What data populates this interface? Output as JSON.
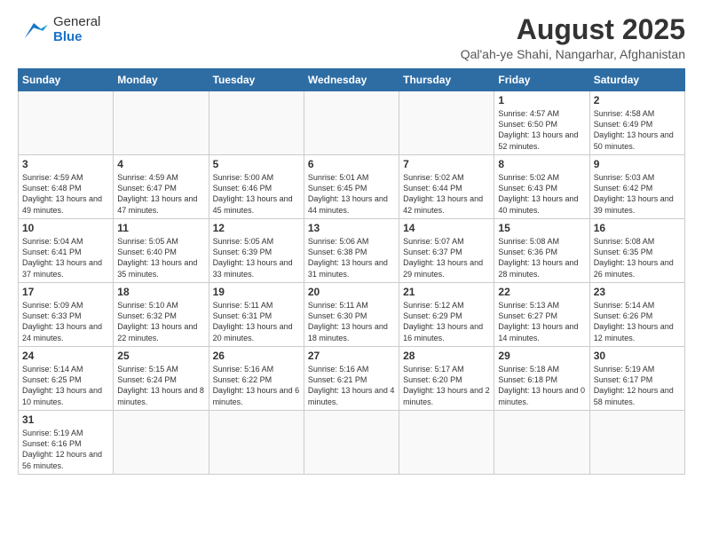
{
  "header": {
    "logo_general": "General",
    "logo_blue": "Blue",
    "title": "August 2025",
    "subtitle": "Qal'ah-ye Shahi, Nangarhar, Afghanistan"
  },
  "weekdays": [
    "Sunday",
    "Monday",
    "Tuesday",
    "Wednesday",
    "Thursday",
    "Friday",
    "Saturday"
  ],
  "weeks": [
    [
      {
        "day": "",
        "info": ""
      },
      {
        "day": "",
        "info": ""
      },
      {
        "day": "",
        "info": ""
      },
      {
        "day": "",
        "info": ""
      },
      {
        "day": "",
        "info": ""
      },
      {
        "day": "1",
        "info": "Sunrise: 4:57 AM\nSunset: 6:50 PM\nDaylight: 13 hours and 52 minutes."
      },
      {
        "day": "2",
        "info": "Sunrise: 4:58 AM\nSunset: 6:49 PM\nDaylight: 13 hours and 50 minutes."
      }
    ],
    [
      {
        "day": "3",
        "info": "Sunrise: 4:59 AM\nSunset: 6:48 PM\nDaylight: 13 hours and 49 minutes."
      },
      {
        "day": "4",
        "info": "Sunrise: 4:59 AM\nSunset: 6:47 PM\nDaylight: 13 hours and 47 minutes."
      },
      {
        "day": "5",
        "info": "Sunrise: 5:00 AM\nSunset: 6:46 PM\nDaylight: 13 hours and 45 minutes."
      },
      {
        "day": "6",
        "info": "Sunrise: 5:01 AM\nSunset: 6:45 PM\nDaylight: 13 hours and 44 minutes."
      },
      {
        "day": "7",
        "info": "Sunrise: 5:02 AM\nSunset: 6:44 PM\nDaylight: 13 hours and 42 minutes."
      },
      {
        "day": "8",
        "info": "Sunrise: 5:02 AM\nSunset: 6:43 PM\nDaylight: 13 hours and 40 minutes."
      },
      {
        "day": "9",
        "info": "Sunrise: 5:03 AM\nSunset: 6:42 PM\nDaylight: 13 hours and 39 minutes."
      }
    ],
    [
      {
        "day": "10",
        "info": "Sunrise: 5:04 AM\nSunset: 6:41 PM\nDaylight: 13 hours and 37 minutes."
      },
      {
        "day": "11",
        "info": "Sunrise: 5:05 AM\nSunset: 6:40 PM\nDaylight: 13 hours and 35 minutes."
      },
      {
        "day": "12",
        "info": "Sunrise: 5:05 AM\nSunset: 6:39 PM\nDaylight: 13 hours and 33 minutes."
      },
      {
        "day": "13",
        "info": "Sunrise: 5:06 AM\nSunset: 6:38 PM\nDaylight: 13 hours and 31 minutes."
      },
      {
        "day": "14",
        "info": "Sunrise: 5:07 AM\nSunset: 6:37 PM\nDaylight: 13 hours and 29 minutes."
      },
      {
        "day": "15",
        "info": "Sunrise: 5:08 AM\nSunset: 6:36 PM\nDaylight: 13 hours and 28 minutes."
      },
      {
        "day": "16",
        "info": "Sunrise: 5:08 AM\nSunset: 6:35 PM\nDaylight: 13 hours and 26 minutes."
      }
    ],
    [
      {
        "day": "17",
        "info": "Sunrise: 5:09 AM\nSunset: 6:33 PM\nDaylight: 13 hours and 24 minutes."
      },
      {
        "day": "18",
        "info": "Sunrise: 5:10 AM\nSunset: 6:32 PM\nDaylight: 13 hours and 22 minutes."
      },
      {
        "day": "19",
        "info": "Sunrise: 5:11 AM\nSunset: 6:31 PM\nDaylight: 13 hours and 20 minutes."
      },
      {
        "day": "20",
        "info": "Sunrise: 5:11 AM\nSunset: 6:30 PM\nDaylight: 13 hours and 18 minutes."
      },
      {
        "day": "21",
        "info": "Sunrise: 5:12 AM\nSunset: 6:29 PM\nDaylight: 13 hours and 16 minutes."
      },
      {
        "day": "22",
        "info": "Sunrise: 5:13 AM\nSunset: 6:27 PM\nDaylight: 13 hours and 14 minutes."
      },
      {
        "day": "23",
        "info": "Sunrise: 5:14 AM\nSunset: 6:26 PM\nDaylight: 13 hours and 12 minutes."
      }
    ],
    [
      {
        "day": "24",
        "info": "Sunrise: 5:14 AM\nSunset: 6:25 PM\nDaylight: 13 hours and 10 minutes."
      },
      {
        "day": "25",
        "info": "Sunrise: 5:15 AM\nSunset: 6:24 PM\nDaylight: 13 hours and 8 minutes."
      },
      {
        "day": "26",
        "info": "Sunrise: 5:16 AM\nSunset: 6:22 PM\nDaylight: 13 hours and 6 minutes."
      },
      {
        "day": "27",
        "info": "Sunrise: 5:16 AM\nSunset: 6:21 PM\nDaylight: 13 hours and 4 minutes."
      },
      {
        "day": "28",
        "info": "Sunrise: 5:17 AM\nSunset: 6:20 PM\nDaylight: 13 hours and 2 minutes."
      },
      {
        "day": "29",
        "info": "Sunrise: 5:18 AM\nSunset: 6:18 PM\nDaylight: 13 hours and 0 minutes."
      },
      {
        "day": "30",
        "info": "Sunrise: 5:19 AM\nSunset: 6:17 PM\nDaylight: 12 hours and 58 minutes."
      }
    ],
    [
      {
        "day": "31",
        "info": "Sunrise: 5:19 AM\nSunset: 6:16 PM\nDaylight: 12 hours and 56 minutes."
      },
      {
        "day": "",
        "info": ""
      },
      {
        "day": "",
        "info": ""
      },
      {
        "day": "",
        "info": ""
      },
      {
        "day": "",
        "info": ""
      },
      {
        "day": "",
        "info": ""
      },
      {
        "day": "",
        "info": ""
      }
    ]
  ]
}
